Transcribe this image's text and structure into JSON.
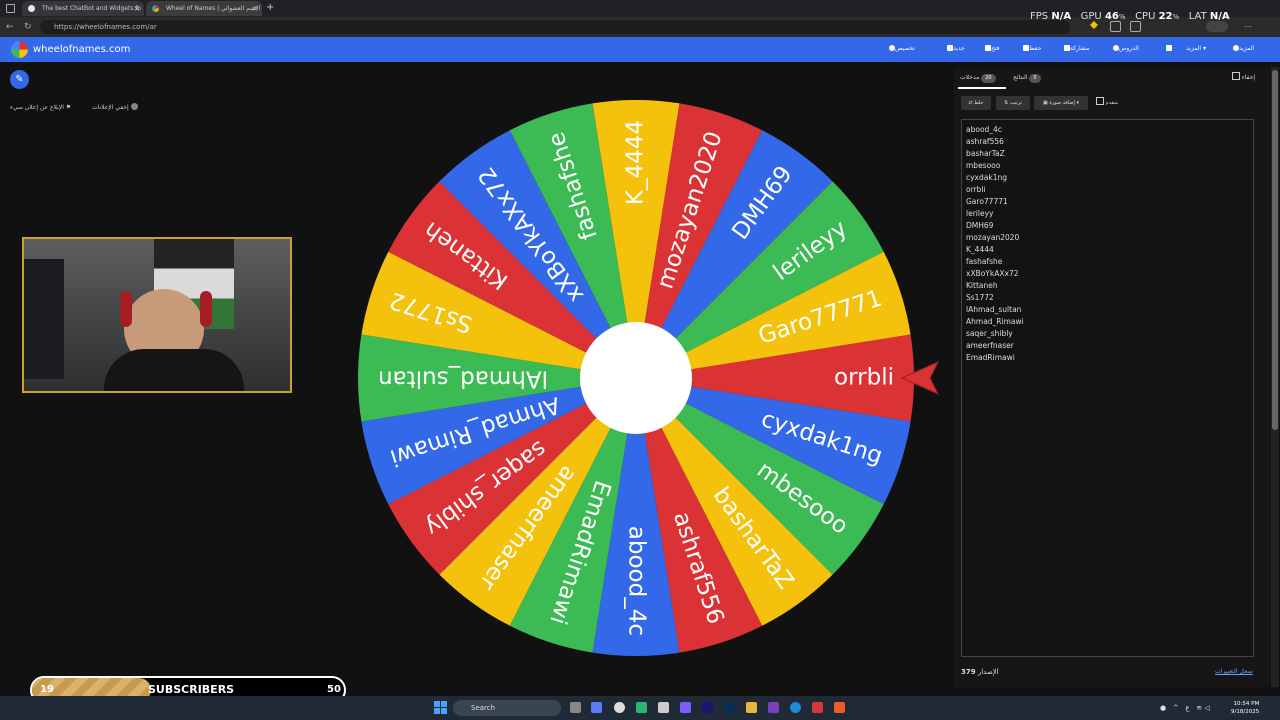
{
  "browser": {
    "tabs": [
      {
        "title": "The best ChatBot and Widgets fo"
      },
      {
        "title": "Wheel of Names | الاسم العشوائي"
      }
    ],
    "new_tab": "+",
    "url": "https://wheelofnames.com/ar"
  },
  "header": {
    "brand": "wheelofnames.com",
    "nav": [
      {
        "label": "المزيد",
        "icon": "globe-icon"
      },
      {
        "label": "المزيد",
        "icon": "chevron-down-icon"
      },
      {
        "label": "",
        "icon": "fullscreen-icon"
      },
      {
        "label": "الدروس",
        "icon": "search-icon"
      },
      {
        "label": "مشاركة",
        "icon": "share-icon"
      },
      {
        "label": "حفظ",
        "icon": "save-icon"
      },
      {
        "label": "فتح",
        "icon": "folder-icon"
      },
      {
        "label": "جديد",
        "icon": "file-icon"
      },
      {
        "label": "تخصيص",
        "icon": "palette-icon"
      }
    ]
  },
  "left": {
    "ads_hide": "إخفي الإعلانات",
    "ads_report": "الإبلاغ عن إعلان سيء"
  },
  "wheel": {
    "pointer_color": "#db3236",
    "colors": [
      "#db3236",
      "#3369e8",
      "#3cba54",
      "#f4c20d"
    ],
    "segments": [
      "orrbli",
      "cyxdak1ng",
      "mbesooo",
      "basharTaZ",
      "ashraf556",
      "abood_4c",
      "EmadRimawi",
      "ameerfnaser",
      "saqer_shibly",
      "Ahmad_Rimawi",
      "lAhmad_sultan",
      "Ss1772",
      "Kittaneh",
      "xXBoYkAXx72",
      "fashafshe",
      "K_4444",
      "mozayan2020",
      "DMH69",
      "lerileyy",
      "Garo77771"
    ]
  },
  "panel": {
    "tabs": [
      {
        "label": "مدخلات",
        "count": "20"
      },
      {
        "label": "النتائج",
        "count": "5"
      }
    ],
    "hide_label": "إخفاء",
    "tools": {
      "shuffle": "خلط",
      "sort": "ترتيب",
      "add_image": "إضافة صورة",
      "advanced": "متقدم"
    },
    "entries": [
      "abood_4c",
      "ashraf556",
      "basharTaZ",
      "mbesooo",
      "cyxdak1ng",
      "orrbli",
      "Garo77771",
      "lerileyy",
      "DMH69",
      "mozayan2020",
      "K_4444",
      "fashafshe",
      "xXBoYkAXx72",
      "Kittaneh",
      "Ss1772",
      "lAhmad_sultan",
      "Ahmad_Rimawi",
      "saqer_shibly",
      "ameerfnaser",
      "EmadRimawi"
    ],
    "version_label": "الإصدار",
    "version": "379",
    "history_link": "سجل التغييرات"
  },
  "stats": {
    "fps_label": "FPS",
    "fps": "N/A",
    "gpu_label": "GPU",
    "gpu": "46",
    "cpu_label": "CPU",
    "cpu": "22",
    "lat_label": "LAT",
    "lat": "N/A",
    "percent": "%"
  },
  "subs": {
    "current": "19",
    "label": "SUBSCRIBERS",
    "goal": "50",
    "progress": 0.38
  },
  "taskbar": {
    "search": "Search",
    "time": "10:54 PM",
    "date": "9/18/2025",
    "lang": "ع"
  }
}
